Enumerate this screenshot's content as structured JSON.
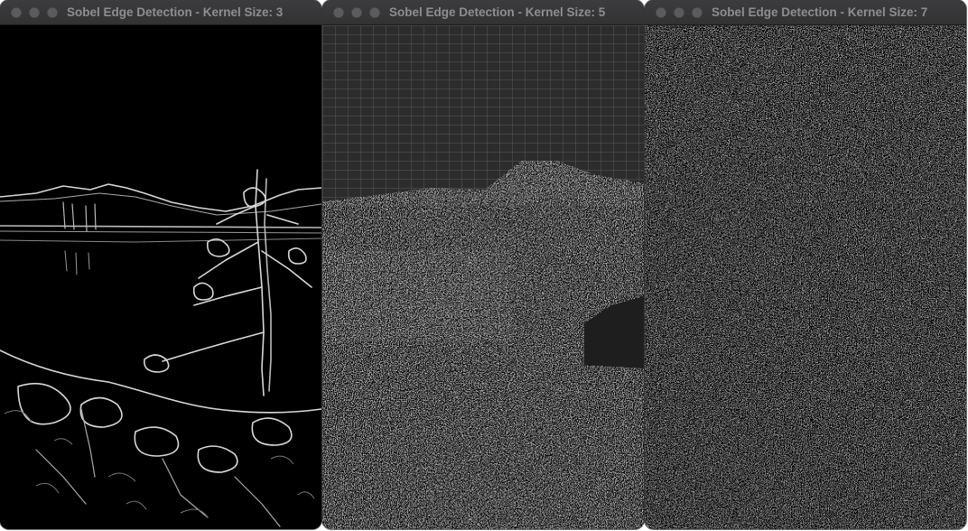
{
  "windows": [
    {
      "title": "Sobel Edge Detection - Kernel Size: 3",
      "kernel_size": 3
    },
    {
      "title": "Sobel Edge Detection - Kernel Size: 5",
      "kernel_size": 5
    },
    {
      "title": "Sobel Edge Detection - Kernel Size: 7",
      "kernel_size": 7
    }
  ],
  "traffic_lights": [
    "close-icon",
    "minimize-icon",
    "zoom-icon"
  ],
  "colors": {
    "titlebar": "#3a3a3c",
    "title_text": "#8e8e92",
    "traffic_inactive": "#5b5b5e",
    "canvas": "#000000",
    "edge": "#ffffff"
  }
}
